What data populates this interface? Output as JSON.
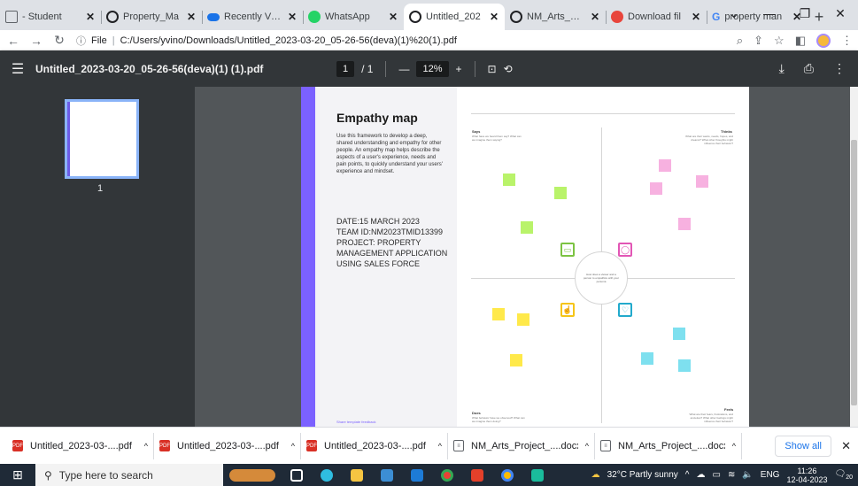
{
  "tabs": [
    {
      "title": "- Student",
      "color": "#5f6368",
      "active": false
    },
    {
      "title": "Property_Ma",
      "color": "#202124",
      "active": false
    },
    {
      "title": "Recently View",
      "color": "#1a73e8",
      "active": false
    },
    {
      "title": "WhatsApp",
      "color": "#25d366",
      "active": false
    },
    {
      "title": "Untitled_202",
      "color": "#202124",
      "active": true
    },
    {
      "title": "NM_Arts_Proj",
      "color": "#202124",
      "active": false
    },
    {
      "title": "Download fil",
      "color": "#e8453c",
      "active": false
    },
    {
      "title": "property man",
      "color": "#4285f4",
      "active": false
    }
  ],
  "omnibox": {
    "scheme": "File",
    "url": "C:/Users/yvino/Downloads/Untitled_2023-03-20_05-26-56(deva)(1)%20(1).pdf"
  },
  "pdf": {
    "filename": "Untitled_2023-03-20_05-26-56(deva)(1) (1).pdf",
    "page_current": "1",
    "page_total": "/ 1",
    "zoom": "12%",
    "thumb_number": "1"
  },
  "doc": {
    "title": "Empathy map",
    "description": "Use this framework to develop a deep, shared understanding and empathy for other people. An empathy map helps describe the aspects of a user's experience, needs and pain points, to quickly understand your users' experience and mindset.",
    "date": "DATE:15 MARCH 2023",
    "team": "TEAM ID:NM2023TMID13399",
    "project": "PROJECT: PROPERTY MANAGEMENT APPLICATION USING SALES FORCE",
    "feedback": "Share template feedback",
    "says": "Says",
    "says_sub": "What have we heard them say? What can we imagine them saying?",
    "thinks": "Thinks",
    "thinks_sub": "What are their wants, needs, hopes, and dreams? What other thoughts might influence their behavior?",
    "does": "Does",
    "does_sub": "What behavior have we observed? What can we imagine them doing?",
    "feels": "Feels",
    "feels_sub": "What are their fears, frustrations, and anxieties? What other feelings might influence their behavior?",
    "center": "How does a viewer and a person to empathize with your persona"
  },
  "downloads": [
    {
      "name": "Untitled_2023-03-....pdf",
      "type": "pdf"
    },
    {
      "name": "Untitled_2023-03-....pdf",
      "type": "pdf"
    },
    {
      "name": "Untitled_2023-03-....pdf",
      "type": "pdf"
    },
    {
      "name": "NM_Arts_Project_....docx",
      "type": "doc"
    },
    {
      "name": "NM_Arts_Project_....docx",
      "type": "doc"
    }
  ],
  "download_bar": {
    "show_all": "Show all"
  },
  "taskbar": {
    "search_placeholder": "Type here to search",
    "weather": "32°C  Partly sunny",
    "lang": "ENG",
    "time": "11:26",
    "date": "12-04-2023",
    "notif": "20"
  }
}
